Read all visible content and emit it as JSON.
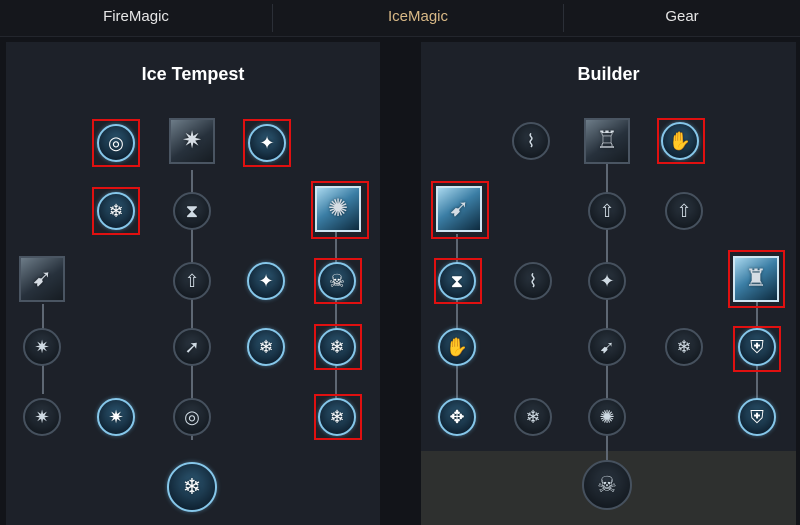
{
  "tabs": {
    "fire": "FireMagic",
    "ice": "IceMagic",
    "gear": "Gear"
  },
  "active_tab": "IceMagic",
  "colors": {
    "active_tab_text": "#d9b986",
    "active_node_ring": "#86c7ea",
    "highlight_box": "#e01010",
    "panel_bg": "#1d2129",
    "page_bg": "#121419"
  },
  "panels": {
    "left": {
      "title": "Ice Tempest"
    },
    "right": {
      "title": "Builder"
    }
  },
  "skill_glyphs": {
    "ring": "◎",
    "snowflake": "❄",
    "sparkle": "✦",
    "hourglass": "⧗",
    "arrow_up": "⇧",
    "shard": "✷",
    "skull": "☠",
    "diagonal_arrow": "➚",
    "shield": "⛨",
    "hand": "✋",
    "figure": "♜",
    "tower": "♖",
    "spiral": "✺",
    "claw": "⌇",
    "dash": "➹",
    "gift": "✥"
  }
}
